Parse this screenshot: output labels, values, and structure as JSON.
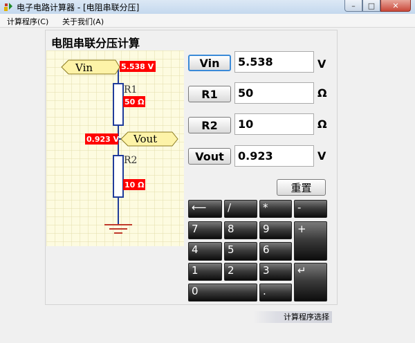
{
  "window": {
    "title": "电子电路计算器 - [电阻串联分压]",
    "minimize": "–",
    "maximize": "□",
    "close": "✕"
  },
  "menu": {
    "items": [
      {
        "label": "计算程序(C)"
      },
      {
        "label": "关于我们(A)"
      }
    ]
  },
  "panel": {
    "title": "电阻串联分压计算"
  },
  "circuit": {
    "vin_label": "Vin",
    "vin_value": "5.538 V",
    "vout_label": "Vout",
    "vout_value": "0.923 V",
    "r1_label": "R1",
    "r1_value": "50 Ω",
    "r2_label": "R2",
    "r2_value": "10 Ω"
  },
  "fields": [
    {
      "label": "Vin",
      "value": "5.538",
      "unit": "V"
    },
    {
      "label": "R1",
      "value": "50",
      "unit": "Ω"
    },
    {
      "label": "R2",
      "value": "10",
      "unit": "Ω"
    },
    {
      "label": "Vout",
      "value": "0.923",
      "unit": "V"
    }
  ],
  "reset_label": "重置",
  "keypad": {
    "backspace": "⟵",
    "divide": "/",
    "multiply": "*",
    "minus": "-",
    "plus": "+",
    "enter": "↵",
    "dot": ".",
    "d0": "0",
    "d1": "1",
    "d2": "2",
    "d3": "3",
    "d4": "4",
    "d5": "5",
    "d6": "6",
    "d7": "7",
    "d8": "8",
    "d9": "9"
  },
  "status_button": "计算程序选择",
  "colors": {
    "grid_bg": "#fdfbe0",
    "grid_line": "#e2deaa",
    "label_red": "#ff0000",
    "wire_blue": "#1f3b9a",
    "tag_yellow": "#fdf3a8",
    "key_dark": "#1a1a1a"
  }
}
